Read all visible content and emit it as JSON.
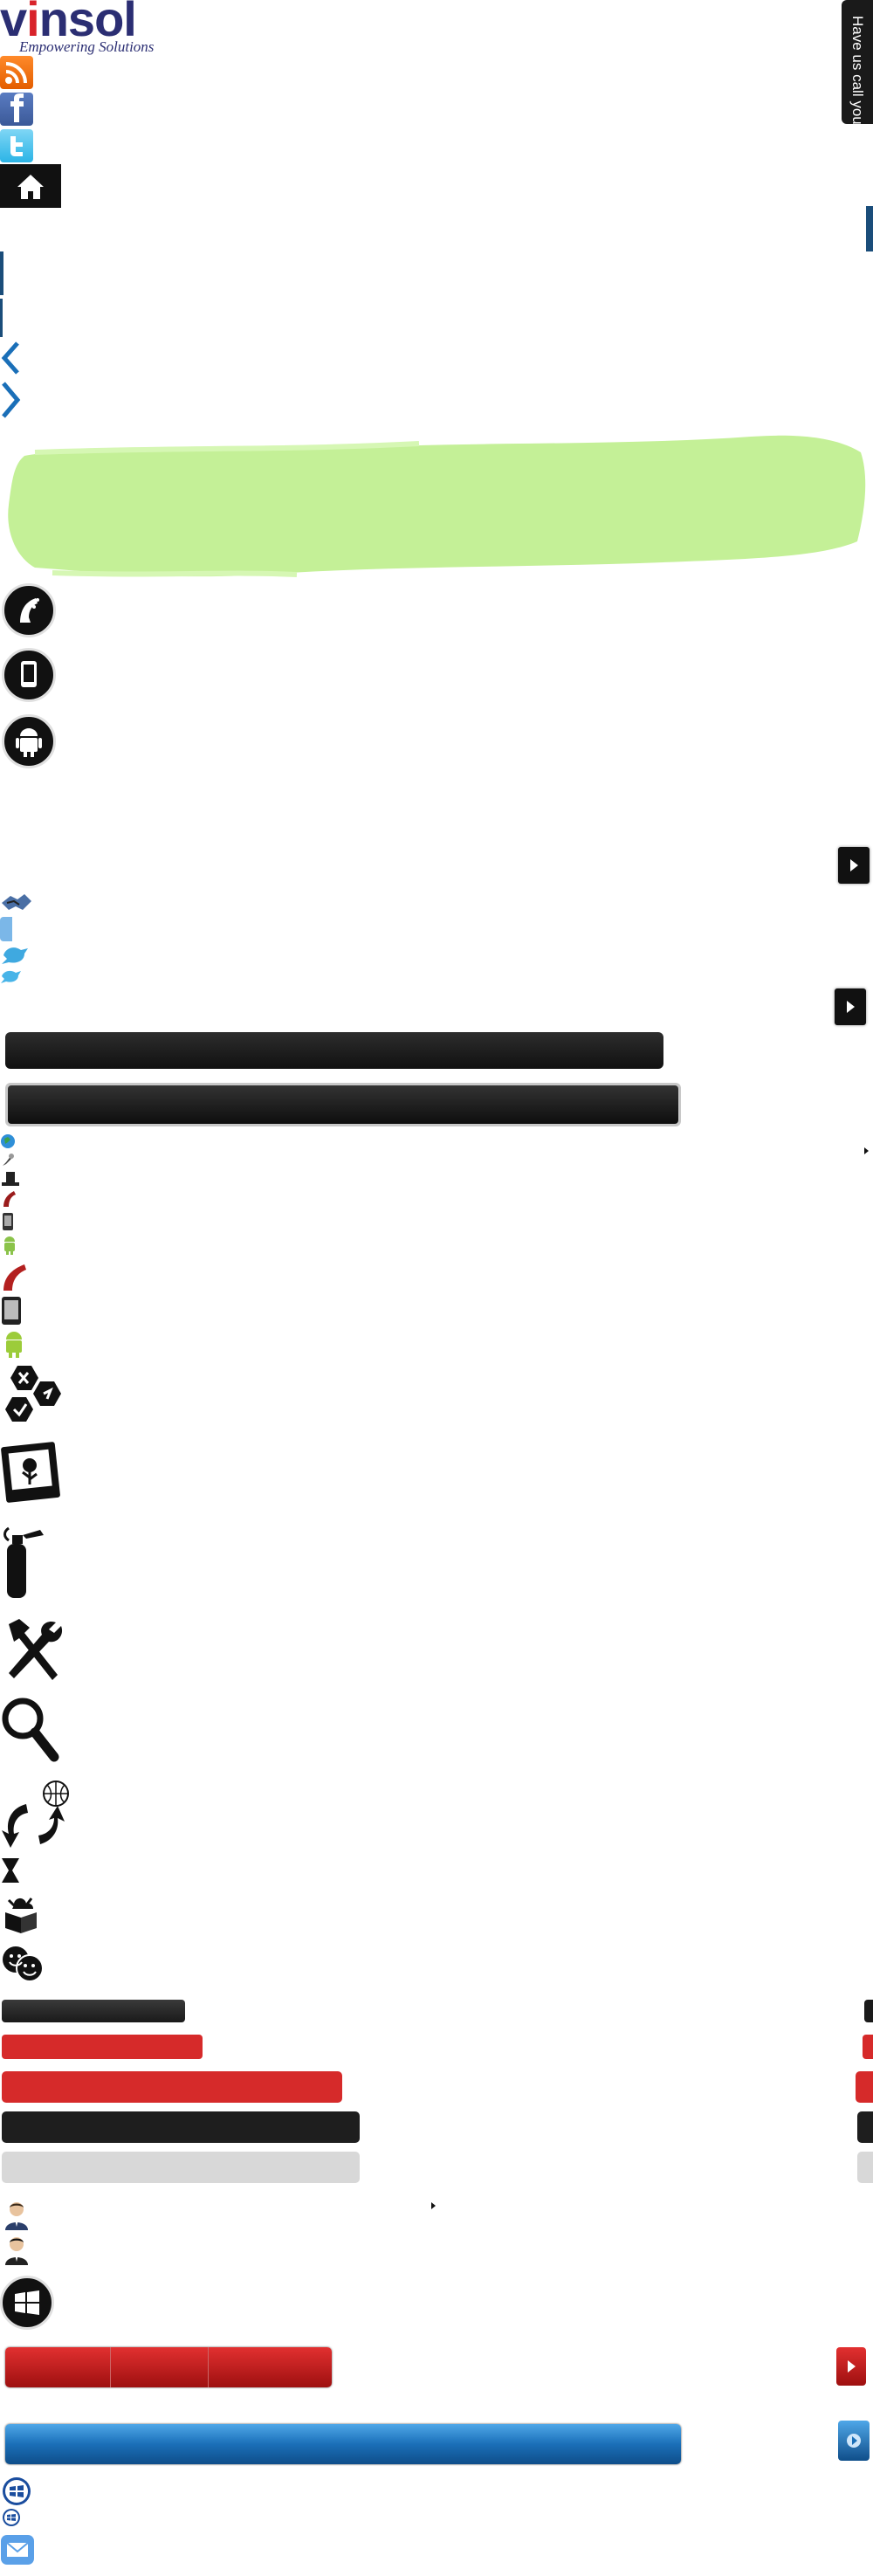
{
  "logo": {
    "word_v": "v",
    "word_i": "i",
    "word_rest": "nsol",
    "tagline": "Empowering Solutions"
  },
  "side_tab": {
    "label": "Have us call you"
  },
  "social": {
    "rss": "rss-icon",
    "facebook": "facebook-icon",
    "twitter": "twitter-icon",
    "home": "home-icon"
  },
  "colors": {
    "brand_navy": "#2b2e73",
    "brand_red": "#d8232a",
    "accent_blue": "#1a6fb8",
    "green_paint": "#c4f097",
    "bar_red": "#d62a2a",
    "bar_gray": "#d8d8d8"
  },
  "progress_bars": [
    {
      "name": "bar-1",
      "fill": 0.21
    },
    {
      "name": "bar-2",
      "fill": 0.23
    },
    {
      "name": "bar-3",
      "fill": 0.39
    },
    {
      "name": "bar-4",
      "fill": 0.41
    },
    {
      "name": "bar-5",
      "fill": 0.41
    }
  ]
}
